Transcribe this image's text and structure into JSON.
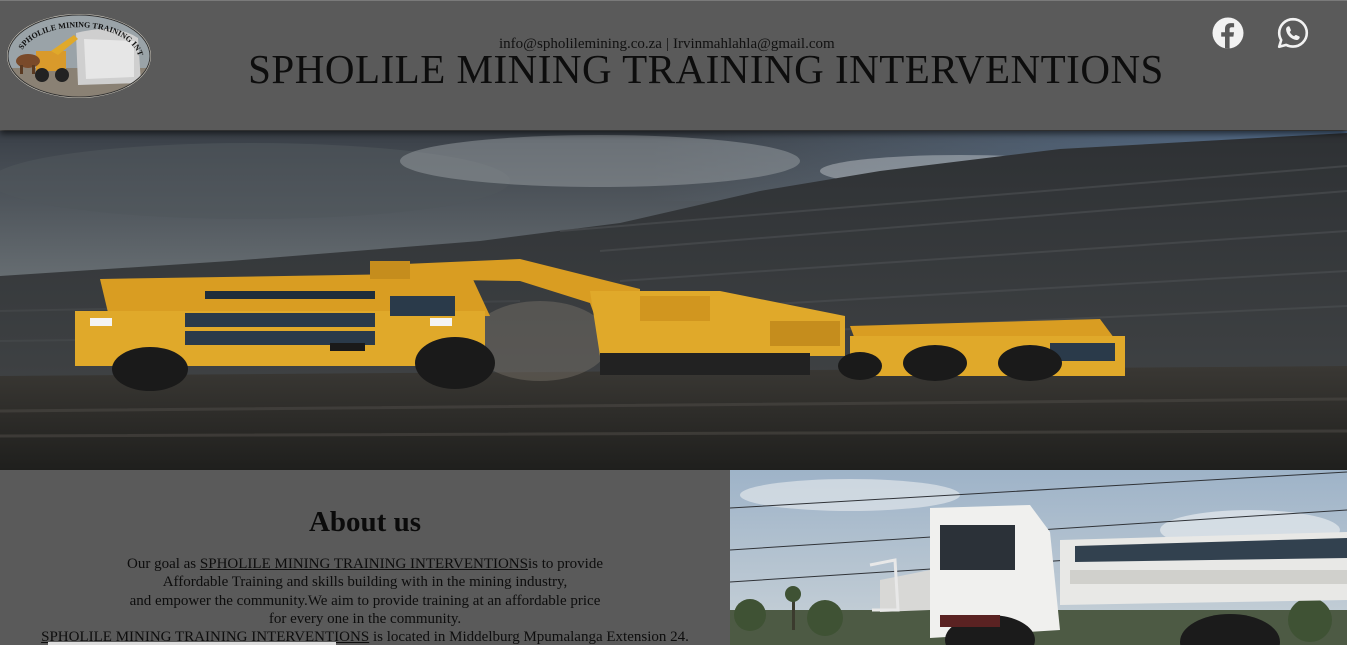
{
  "header": {
    "email_primary": "info@spholilemining.co.za",
    "separator": "|",
    "email_secondary": "Irvinmahlahla@gmail.com",
    "title": "SPHOLILE MINING TRAINING INTERVENTIONS",
    "social": [
      {
        "name": "facebook",
        "icon": "facebook-icon"
      },
      {
        "name": "whatsapp",
        "icon": "whatsapp-icon"
      }
    ]
  },
  "hero": {
    "image": "mining trucks and excavator in open-pit coal mine"
  },
  "about": {
    "heading": "About us",
    "line1_prefix": "Our goal as ",
    "line1_link": "SPHOLILE MINING TRAINING INTERVENTIONS",
    "line1_suffix": "is to provide",
    "line2": "Affordable Training and skills building with in the mining industry,",
    "line3": "and empower the community.We aim to provide training at an affordable price",
    "line4": "for every one in the community.",
    "line5_link": "SPHOLILE MINING TRAINING INTERVENTIONS",
    "line5_suffix": " is located in Middelburg Mpumalanga Extension 24."
  },
  "colors": {
    "header_bg": "#5a5a5a",
    "section_bg": "#5a5a5a",
    "truck_yellow": "#e0a92a",
    "icon_color": "#f2f2f2"
  }
}
